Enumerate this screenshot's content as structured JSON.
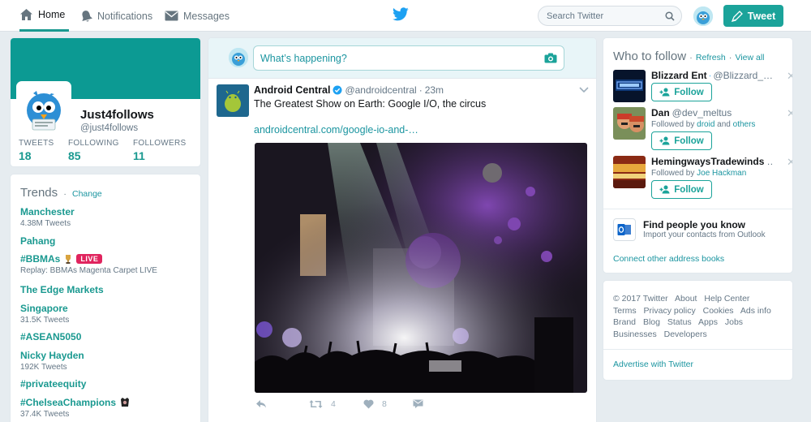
{
  "nav": {
    "home": "Home",
    "notifications": "Notifications",
    "messages": "Messages",
    "search_placeholder": "Search Twitter",
    "tweet_button": "Tweet"
  },
  "profile": {
    "name": "Just4follows",
    "handle": "@just4follows",
    "stats": [
      {
        "label": "TWEETS",
        "value": "18"
      },
      {
        "label": "FOLLOWING",
        "value": "85"
      },
      {
        "label": "FOLLOWERS",
        "value": "11"
      }
    ]
  },
  "trends": {
    "title": "Trends",
    "change": "Change",
    "items": [
      {
        "name": "Manchester",
        "sub": "4.38M Tweets"
      },
      {
        "name": "Pahang",
        "sub": ""
      },
      {
        "name": "#BBMAs",
        "sub": "Replay: BBMAs Magenta Carpet LIVE",
        "badge": "LIVE"
      },
      {
        "name": "The Edge Markets",
        "sub": ""
      },
      {
        "name": "Singapore",
        "sub": "31.5K Tweets"
      },
      {
        "name": "#ASEAN5050",
        "sub": ""
      },
      {
        "name": "Nicky Hayden",
        "sub": "192K Tweets"
      },
      {
        "name": "#privateequity",
        "sub": ""
      },
      {
        "name": "#ChelseaChampions",
        "sub": "37.4K Tweets"
      }
    ]
  },
  "composer": {
    "placeholder": "What’s happening?"
  },
  "tweet": {
    "author": "Android Central",
    "handle": "@androidcentral",
    "sep": "·",
    "time": "23m",
    "text": "The Greatest Show on Earth: Google I/O, the circus",
    "link": "androidcentral.com/google-io-and-…",
    "retweets": "4",
    "likes": "8"
  },
  "who_to_follow": {
    "title": "Who to follow",
    "sep": "·",
    "refresh": "Refresh",
    "view_all": "View all",
    "follow_label": "Follow",
    "accounts": [
      {
        "name": "Blizzard Ent",
        "handle": "@Blizzard_…",
        "sub_prefix": "",
        "sub_link1": "",
        "sub_mid": "",
        "sub_link2": ""
      },
      {
        "name": "Dan",
        "handle": "@dev_meltus",
        "sub_prefix": "Followed by ",
        "sub_link1": "droid",
        "sub_mid": " and ",
        "sub_link2": "others"
      },
      {
        "name": "HemingwaysTradewinds",
        "handle": "…",
        "sub_prefix": "Followed by ",
        "sub_link1": "Joe Hackman",
        "sub_mid": "",
        "sub_link2": ""
      }
    ],
    "find_people_title": "Find people you know",
    "find_people_sub": "Import your contacts from Outlook",
    "connect_link": "Connect other address books"
  },
  "footer": {
    "links": [
      "© 2017 Twitter",
      "About",
      "Help Center",
      "Terms",
      "Privacy policy",
      "Cookies",
      "Ads info",
      "Brand",
      "Blog",
      "Status",
      "Apps",
      "Jobs",
      "Businesses",
      "Developers"
    ],
    "advertise": "Advertise with Twitter"
  },
  "colors": {
    "accent": "#1ba39a",
    "banner": "#0c9a93",
    "link": "#1b95a0",
    "live": "#e0245e",
    "twitter_blue": "#1da1f2"
  },
  "icons": [
    "home-icon",
    "bell-icon",
    "envelope-icon",
    "twitter-bird-icon",
    "search-icon",
    "compose-icon",
    "camera-icon",
    "verified-icon",
    "chevron-down-icon",
    "reply-icon",
    "retweet-icon",
    "heart-icon",
    "dm-icon",
    "add-user-icon",
    "close-icon",
    "outlook-icon"
  ]
}
